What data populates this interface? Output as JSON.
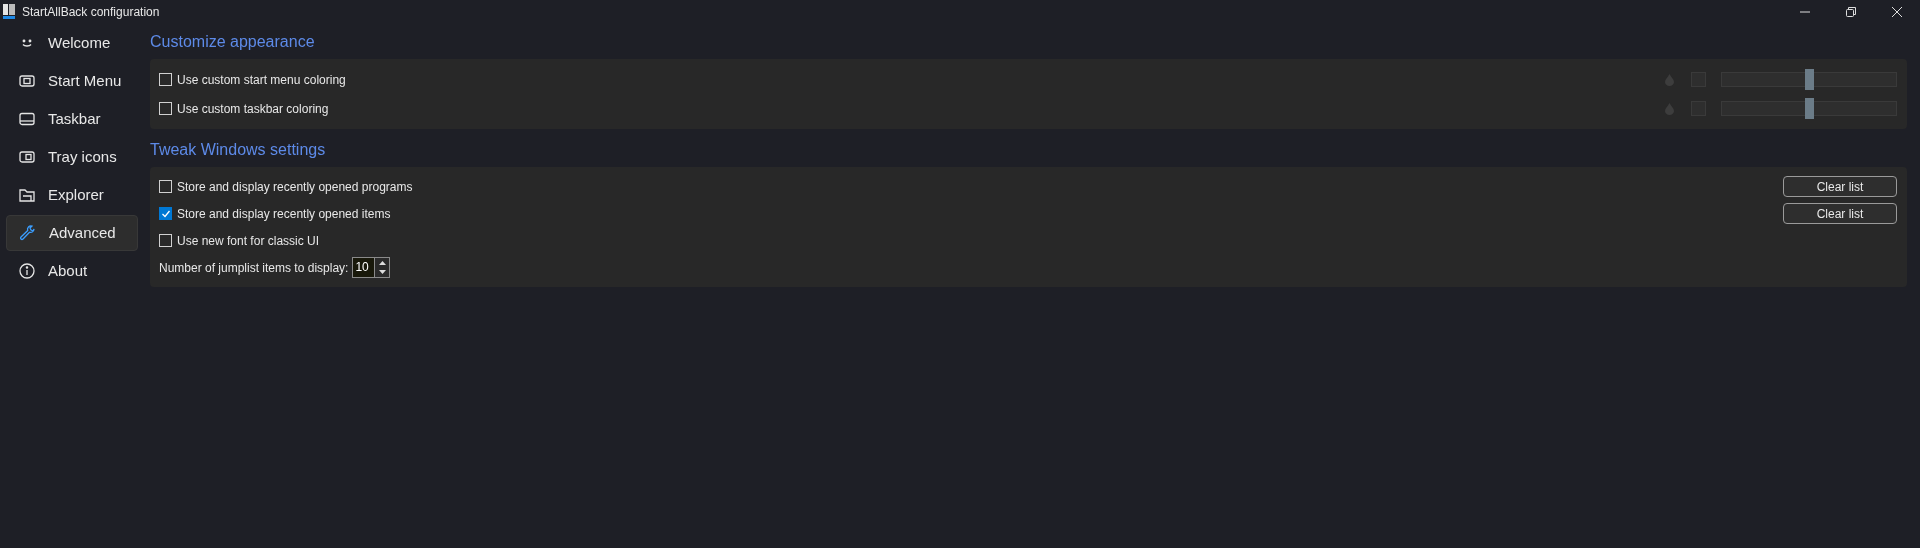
{
  "window": {
    "title": "StartAllBack configuration"
  },
  "sidebar": {
    "items": [
      {
        "label": "Welcome",
        "selected": false
      },
      {
        "label": "Start Menu",
        "selected": false
      },
      {
        "label": "Taskbar",
        "selected": false
      },
      {
        "label": "Tray icons",
        "selected": false
      },
      {
        "label": "Explorer",
        "selected": false
      },
      {
        "label": "Advanced",
        "selected": true
      },
      {
        "label": "About",
        "selected": false
      }
    ]
  },
  "sections": [
    {
      "title": "Customize appearance",
      "rows": [
        {
          "kind": "color",
          "label": "Use custom start menu coloring",
          "checked": false,
          "level": 0.5
        },
        {
          "kind": "color",
          "label": "Use custom taskbar coloring",
          "checked": false,
          "level": 0.5
        }
      ]
    },
    {
      "title": "Tweak Windows settings",
      "rows": [
        {
          "kind": "clear",
          "label": "Store and display recently opened programs",
          "checked": false,
          "button": "Clear list"
        },
        {
          "kind": "clear",
          "label": "Store and display recently opened items",
          "checked": true,
          "button": "Clear list"
        },
        {
          "kind": "check",
          "label": "Use new font for classic UI",
          "checked": false
        },
        {
          "kind": "spin",
          "label": "Number of jumplist items to display:",
          "value": "10"
        }
      ]
    }
  ]
}
